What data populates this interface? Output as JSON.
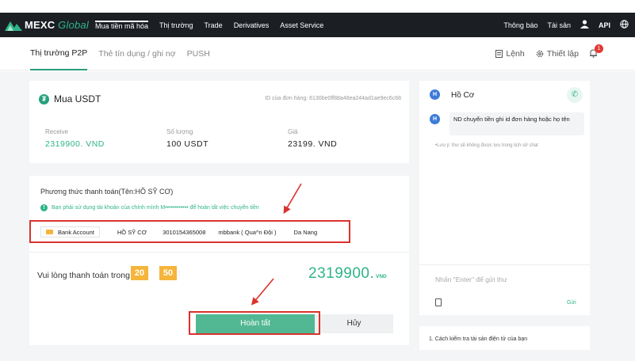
{
  "nav": {
    "brand_main": "MEXC",
    "brand_sub": "Global",
    "items": [
      "Mua tiền mã hóa",
      "Thị trường",
      "Trade",
      "Derivatives",
      "Asset Service"
    ],
    "notify": "Thông báo",
    "assets": "Tài sản",
    "api": "API"
  },
  "subnav": {
    "tabs": [
      "Thị trường P2P",
      "Thẻ tín dụng / ghi nợ",
      "PUSH"
    ],
    "orders": "Lệnh",
    "settings": "Thiết lập",
    "badge_count": "1"
  },
  "order": {
    "title": "Mua USDT",
    "order_id": "ID của đơn hàng: 6130be0ff88a48ea244ad1ae9ec6c68",
    "receive_label": "Receive",
    "receive_value": "2319900.  VND",
    "qty_label": "Số lượng",
    "qty_value": "100  USDT",
    "price_label": "Giá",
    "price_value": "23199.  VND"
  },
  "payment": {
    "title": "Phương thức thanh toán(Tên:HỒ SỸ CƠ)",
    "warning": "Bạn phải sử dụng tài khoản của chính mình M•••••••••••• để hoàn tất việc chuyển tiền",
    "bank_button": "Bank Account",
    "name": "HỒ SỸ CƠ",
    "account": "3010154365008",
    "bank": "mbbank ( Qua^n Đội )",
    "city": "Da Nang",
    "pay_prompt": "Vui lòng thanh toán trong",
    "min": "20",
    "sec": "50",
    "amount": "2319900.",
    "currency": "VND",
    "confirm": "Hoàn tất",
    "cancel": "Hủy"
  },
  "chat": {
    "avatar": "H",
    "name": "Hồ Cơ",
    "message": "ND chuyển tiền ghi id đơn hàng hoặc họ tên",
    "note": "•Lưu ý: thư sẽ không được lưu trong lịch sử chat",
    "input_placeholder": "Nhấn \"Enter\" để gửi thư",
    "send": "Gửi"
  },
  "faq": {
    "first": "1. Cách kiểm tra tài sản điện tử của bạn"
  },
  "colors": {
    "accent": "#2fb48a",
    "timer": "#f5b53a",
    "annotation": "#d9332c"
  }
}
